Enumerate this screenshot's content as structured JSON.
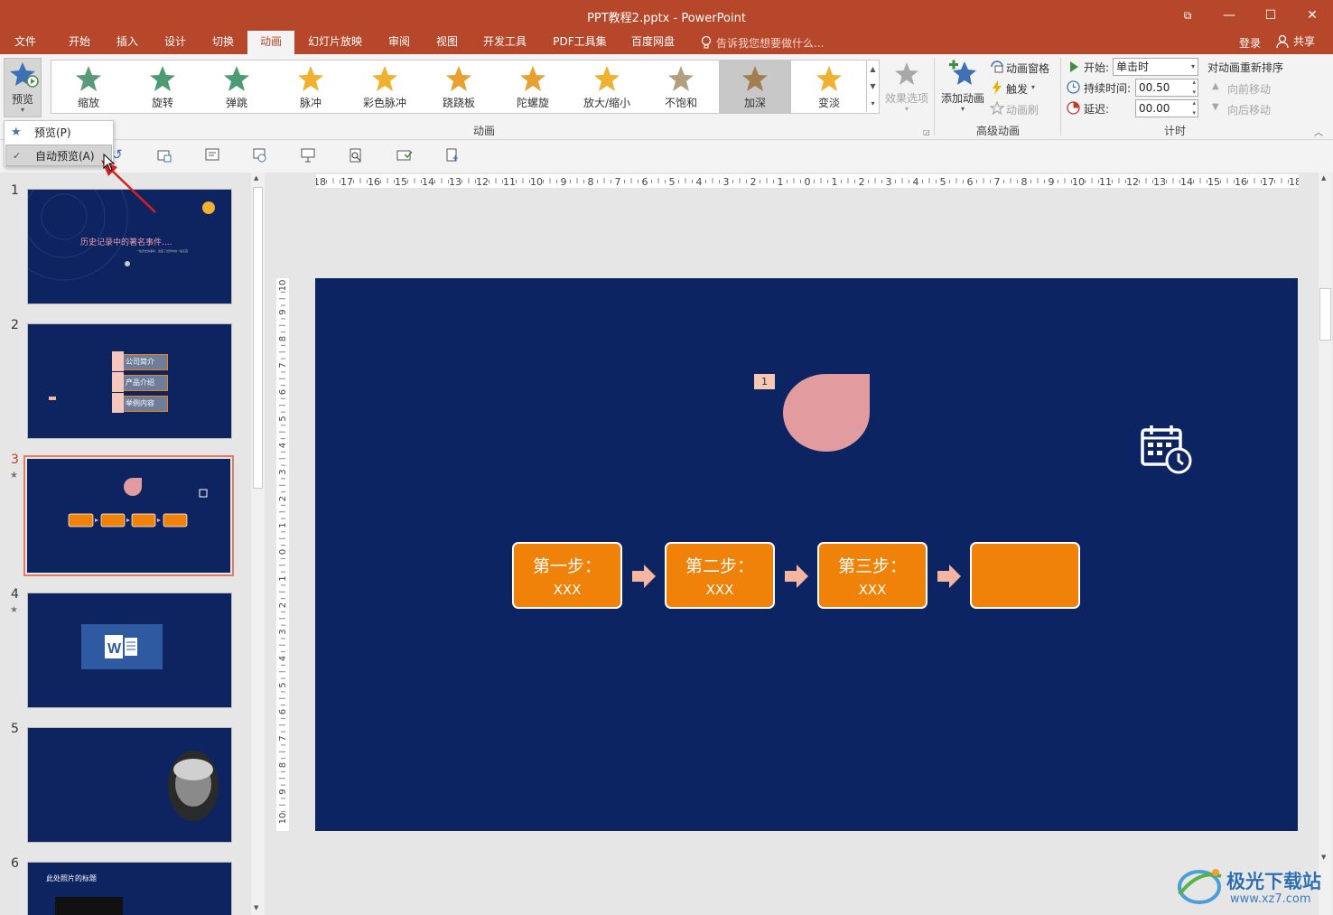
{
  "window": {
    "title": "PPT教程2.pptx - PowerPoint",
    "controls": {
      "restore": "⧉",
      "minimize": "—",
      "maximize": "☐",
      "close": "✕"
    }
  },
  "tabs": [
    "文件",
    "开始",
    "插入",
    "设计",
    "切换",
    "动画",
    "幻灯片放映",
    "审阅",
    "视图",
    "开发工具",
    "PDF工具集",
    "百度网盘"
  ],
  "active_tab": "动画",
  "tellme": "告诉我您想要做什么...",
  "account": {
    "login": "登录",
    "share": "共享"
  },
  "ribbon": {
    "preview": {
      "label": "预览"
    },
    "animation_group": {
      "label": "动画",
      "items": [
        "缩放",
        "旋转",
        "弹跳",
        "脉冲",
        "彩色脉冲",
        "跷跷板",
        "陀螺旋",
        "放大/缩小",
        "不饱和",
        "加深",
        "变淡"
      ],
      "selected": "加深",
      "effect_options": "效果选项"
    },
    "advanced_group": {
      "label": "高级动画",
      "add_animation": "添加动画",
      "animation_pane": "动画窗格",
      "trigger": "触发",
      "painter": "动画刷"
    },
    "timing_group": {
      "label": "计时",
      "start_label": "开始:",
      "start_value": "单击时",
      "duration_label": "持续时间:",
      "duration_value": "00.50",
      "delay_label": "延迟:",
      "delay_value": "00.00",
      "reorder": "对动画重新排序",
      "move_earlier": "向前移动",
      "move_later": "向后移动"
    }
  },
  "dropdown": {
    "items": [
      {
        "label": "预览(P)"
      },
      {
        "label": "自动预览(A)",
        "checked": true
      }
    ]
  },
  "slides": [
    {
      "number": "1",
      "title": "历史记录中的著名事件....",
      "subtitle": "一些历史的事件，改变了世界中的一些东西"
    },
    {
      "number": "2",
      "items": [
        "公司简介",
        "产品介绍",
        "举例内容"
      ]
    },
    {
      "number": "3",
      "selected": true
    },
    {
      "number": "4"
    },
    {
      "number": "5"
    },
    {
      "number": "6",
      "title": "此处照片的标题"
    }
  ],
  "ruler": {
    "h_ticks": [
      "18",
      "17",
      "16",
      "15",
      "14",
      "13",
      "12",
      "11",
      "10",
      "9",
      "8",
      "7",
      "6",
      "5",
      "4",
      "3",
      "2",
      "1",
      "0",
      "1",
      "2",
      "3",
      "4",
      "5",
      "6",
      "7",
      "8",
      "9",
      "10",
      "11",
      "12",
      "13",
      "14",
      "15",
      "16",
      "17",
      "18"
    ],
    "v_ticks": [
      "10",
      "9",
      "8",
      "7",
      "6",
      "5",
      "4",
      "3",
      "2",
      "1",
      "0",
      "1",
      "2",
      "3",
      "4",
      "5",
      "6",
      "7",
      "8",
      "9",
      "10"
    ]
  },
  "slide": {
    "animation_tag": "1",
    "steps": [
      {
        "line1": "第一步：",
        "line2": "XXX"
      },
      {
        "line1": "第二步：",
        "line2": "XXX"
      },
      {
        "line1": "第三步：",
        "line2": "XXX"
      },
      {
        "line1": "",
        "line2": ""
      }
    ]
  },
  "watermark": {
    "text": "极光下载站",
    "url": "www.xz7.com"
  },
  "colors": {
    "accent": "#b7472a",
    "slide_bg": "#0c2461",
    "step_fill": "#f0820a",
    "drop_fill": "#e29ca0",
    "arrow_fill": "#f4b6a0"
  }
}
